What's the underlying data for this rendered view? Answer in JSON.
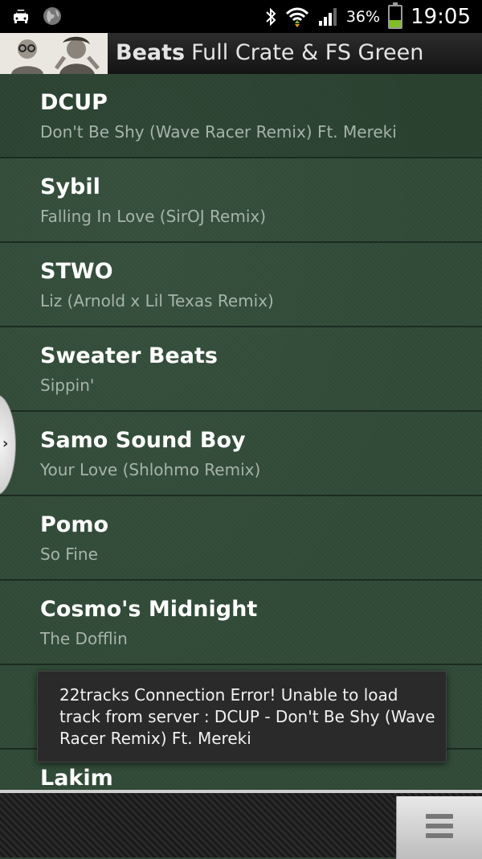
{
  "status_bar": {
    "battery_percent": "36%",
    "battery_level": 0.36,
    "time": "19:05",
    "icons": [
      "car-mode-icon",
      "globe-icon",
      "bluetooth-icon",
      "wifi-icon",
      "signal-icon",
      "battery-icon"
    ]
  },
  "header": {
    "title_strong": "Beats",
    "title_rest": "Full Crate & FS Green"
  },
  "tracks": [
    {
      "artist": "DCUP",
      "song": "Don't Be Shy (Wave Racer Remix) Ft. Mereki"
    },
    {
      "artist": "Sybil",
      "song": "Falling In Love (SirOJ Remix)"
    },
    {
      "artist": "STWO",
      "song": "Liz (Arnold x Lil Texas Remix)"
    },
    {
      "artist": "Sweater Beats",
      "song": "Sippin'"
    },
    {
      "artist": "Samo Sound Boy",
      "song": "Your Love (Shlohmo Remix)"
    },
    {
      "artist": "Pomo",
      "song": "So Fine"
    },
    {
      "artist": "Cosmo's Midnight",
      "song": "The Dofflin"
    },
    {
      "artist": "",
      "song": ""
    },
    {
      "artist": "Lakim",
      "song": ""
    }
  ],
  "toast": {
    "message": "22tracks Connection Error! Unable to load track from server : DCUP - Don't Be Shy (Wave Racer Remix) Ft. Mereki"
  },
  "colors": {
    "list_background": "#304a37",
    "battery_fill": "#7fbf23"
  }
}
